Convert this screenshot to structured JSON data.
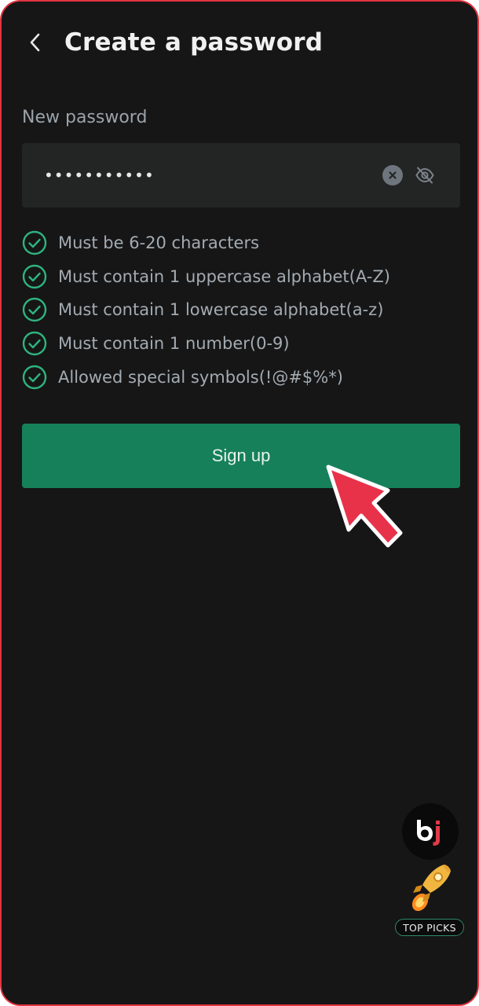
{
  "header": {
    "title": "Create a password"
  },
  "password": {
    "label": "New password",
    "value": "•••••••••••"
  },
  "rules": [
    {
      "text": "Must be 6-20 characters",
      "met": true
    },
    {
      "text": "Must contain 1 uppercase alphabet(A-Z)",
      "met": true
    },
    {
      "text": "Must contain 1 lowercase alphabet(a-z)",
      "met": true
    },
    {
      "text": "Must contain 1 number(0-9)",
      "met": true
    },
    {
      "text": "Allowed special symbols(!@#$%*)",
      "met": true
    }
  ],
  "actions": {
    "signup_label": "Sign up"
  },
  "floating": {
    "brand_logo_text": "bj",
    "top_picks_label": "TOP PICKS"
  },
  "colors": {
    "background": "#161616",
    "accent_green": "#16805b",
    "check_green": "#2fb37f",
    "frame_border": "#e3333f",
    "cursor_red": "#e8324a"
  },
  "icons": {
    "back": "chevron-left-icon",
    "clear": "clear-circle-icon",
    "visibility": "eye-off-icon",
    "rule_check": "check-circle-icon",
    "cursor": "pointer-arrow-icon",
    "rocket": "rocket-icon"
  }
}
